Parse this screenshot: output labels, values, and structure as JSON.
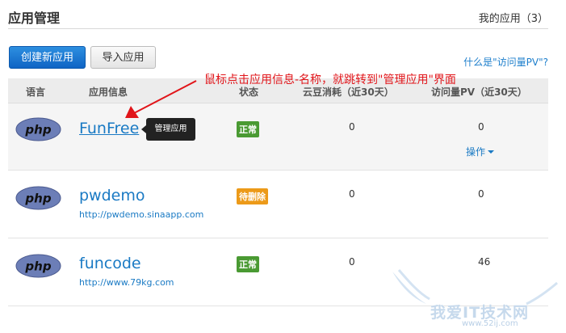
{
  "header": {
    "title": "应用管理",
    "my_apps": "我的应用（3）"
  },
  "toolbar": {
    "create_label": "创建新应用",
    "import_label": "导入应用",
    "pv_help": "什么是\"访问量PV\"?"
  },
  "table": {
    "headers": [
      "语言",
      "应用信息",
      "状态",
      "云豆消耗（近30天）",
      "访问量PV（近30天）"
    ],
    "rows": [
      {
        "lang": "php",
        "name": "FunFree",
        "url": "",
        "status": "正常",
        "beans": "0",
        "pv": "0",
        "ops": "操作"
      },
      {
        "lang": "php",
        "name": "pwdemo",
        "url": "http://pwdemo.sinaapp.com",
        "status": "待删除",
        "beans": "0",
        "pv": "0"
      },
      {
        "lang": "php",
        "name": "funcode",
        "url": "http://www.79kg.com",
        "status": "正常",
        "beans": "0",
        "pv": "46"
      }
    ]
  },
  "tooltip": "管理应用",
  "annotation": "鼠标点击应用信息-名称，就跳转到\"管理应用\"界面",
  "watermark": {
    "text": "我爱IT技术网",
    "url": "www.52ij.com"
  },
  "colors": {
    "primary": "#1a7ac4",
    "ok": "#4a9a33",
    "pending": "#ec9a19",
    "annotation": "#e1151a"
  }
}
